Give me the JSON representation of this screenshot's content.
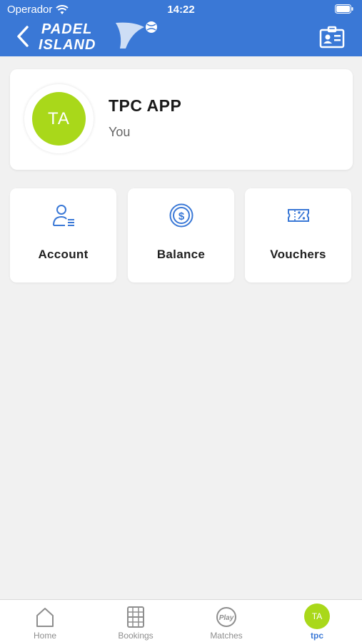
{
  "status_bar": {
    "carrier": "Operador",
    "time": "14:22"
  },
  "header": {
    "logo_line1": "PADEL",
    "logo_line2": "ISLAND"
  },
  "user": {
    "initials": "TA",
    "name": "TPC APP",
    "subtitle": "You"
  },
  "tiles": [
    {
      "label": "Account",
      "icon": "account-icon"
    },
    {
      "label": "Balance",
      "icon": "balance-coin-icon"
    },
    {
      "label": "Vouchers",
      "icon": "voucher-ticket-icon"
    }
  ],
  "tabbar": [
    {
      "label": "Home",
      "icon": "home-icon"
    },
    {
      "label": "Bookings",
      "icon": "court-icon"
    },
    {
      "label": "Matches",
      "icon": "play-ball-icon"
    },
    {
      "label": "tpc",
      "icon": "avatar",
      "initials": "TA",
      "active": true
    }
  ],
  "colors": {
    "brand_blue": "#3a78d6",
    "avatar_green": "#a9d81a",
    "background": "#f1f1f1"
  }
}
